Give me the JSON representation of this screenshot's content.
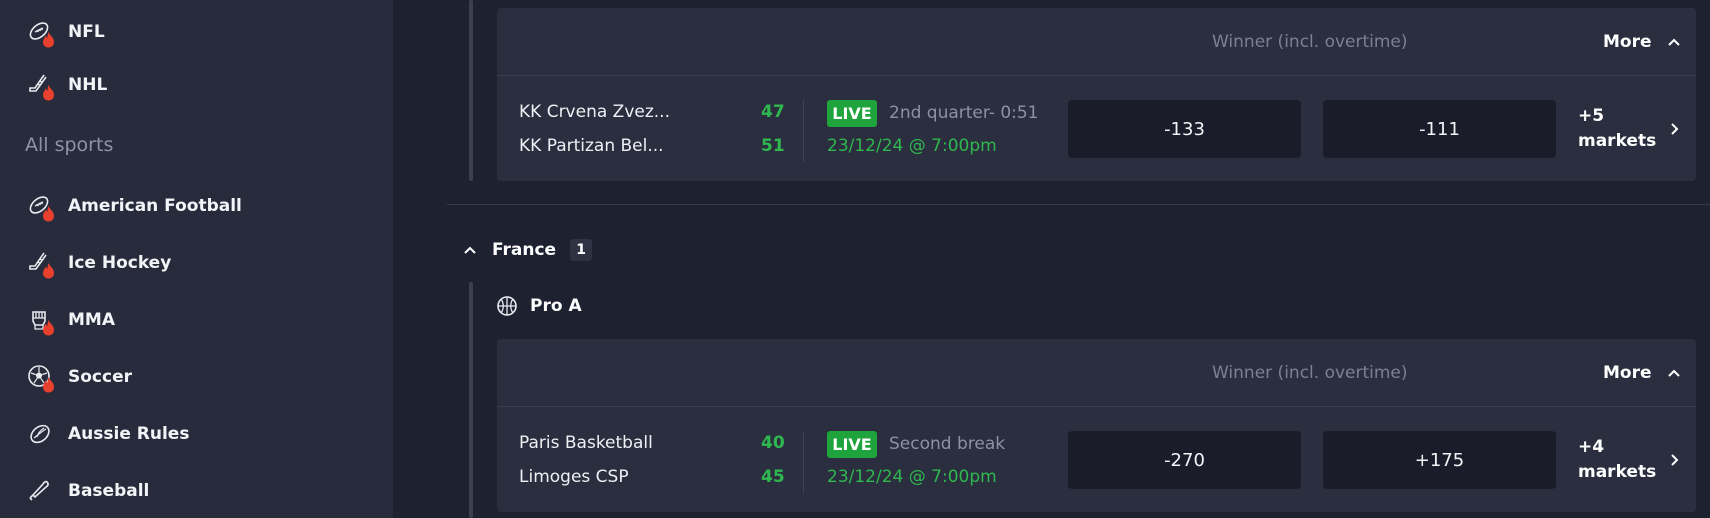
{
  "sidebar": {
    "top_items": [
      {
        "label": "NFL",
        "icon": "football-icon"
      },
      {
        "label": "NHL",
        "icon": "hockey-stick-icon"
      }
    ],
    "heading": "All sports",
    "items": [
      {
        "label": "American Football",
        "icon": "football-icon"
      },
      {
        "label": "Ice Hockey",
        "icon": "hockey-stick-icon"
      },
      {
        "label": "MMA",
        "icon": "glove-icon"
      },
      {
        "label": "Soccer",
        "icon": "soccer-ball-icon"
      },
      {
        "label": "Aussie Rules",
        "icon": "aussie-ball-icon"
      },
      {
        "label": "Baseball",
        "icon": "baseball-bat-icon"
      }
    ],
    "hot_badge_icon": "fire-icon"
  },
  "events": [
    {
      "market_title": "Winner (incl. overtime)",
      "more_label": "More",
      "team1": "KK Crvena Zvez...",
      "team2": "KK Partizan Bel...",
      "score1": "47",
      "score2": "51",
      "live_label": "LIVE",
      "status": "2nd quarter- 0:51",
      "date": "23/12/24 @ 7:00pm",
      "odd1": "-133",
      "odd2": "-111",
      "markets_line1": "+5",
      "markets_line2": "markets"
    },
    {
      "market_title": "Winner (incl. overtime)",
      "more_label": "More",
      "team1": "Paris Basketball",
      "team2": "Limoges CSP",
      "score1": "40",
      "score2": "45",
      "live_label": "LIVE",
      "status": "Second break",
      "date": "23/12/24 @ 7:00pm",
      "odd1": "-270",
      "odd2": "+175",
      "markets_line1": "+4",
      "markets_line2": "markets"
    }
  ],
  "country": {
    "name": "France",
    "count": "1"
  },
  "league": {
    "name": "Pro A",
    "icon": "basketball-icon"
  },
  "colors": {
    "background": "#1d2130",
    "sidebar": "#272b3b",
    "card": "#2a2e3e",
    "odd_button": "#1a1d29",
    "live_green": "#1fa43d",
    "score_green": "#2fb84f",
    "muted_text": "#8d92a3"
  }
}
